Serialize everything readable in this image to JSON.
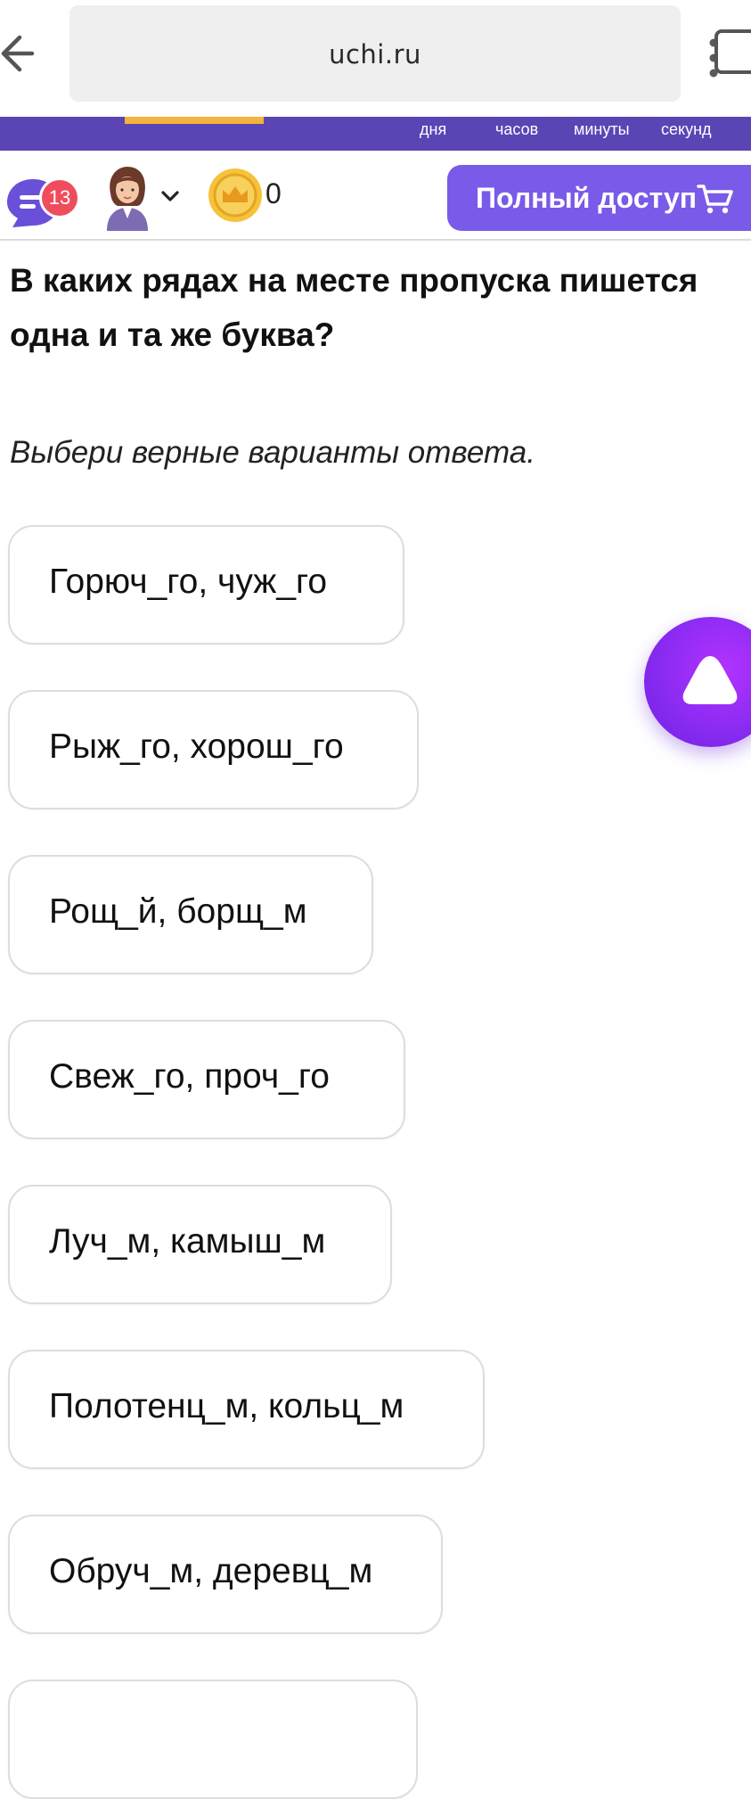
{
  "browser": {
    "url": "uchi.ru",
    "tab_count": ""
  },
  "timer": {
    "days_label": "дня",
    "hours_label": "часов",
    "minutes_label": "минуты",
    "seconds_label": "секунд"
  },
  "header": {
    "notification_count": "13",
    "coins": "0",
    "full_access_label": "Полный доступ"
  },
  "question": {
    "title": "В каких рядах на месте пропуска пишется одна и та же буква?",
    "instruction": "Выбери верные варианты ответа."
  },
  "options": [
    {
      "text": "Горюч_го, чуж_го"
    },
    {
      "text": "Рыж_го, хорош_го"
    },
    {
      "text": "Рощ_й, борщ_м"
    },
    {
      "text": "Свеж_го, проч_го"
    },
    {
      "text": "Луч_м, камыш_м"
    },
    {
      "text": "Полотенц_м, кольц_м"
    },
    {
      "text": "Обруч_м, деревц_м"
    },
    {
      "text": ""
    }
  ],
  "colors": {
    "brand_purple": "#7a5ae8",
    "timer_strip": "#5b45b5",
    "badge_red": "#ef4d5c",
    "coin_yellow": "#f6c23b",
    "alice_purple": "#8b2bf2"
  },
  "icons": {
    "back": "arrow-left",
    "menu": "vertical-dots",
    "chat": "chat-bubble",
    "coin": "crown-coin",
    "cart": "shopping-cart",
    "assistant": "alice-triangle"
  }
}
